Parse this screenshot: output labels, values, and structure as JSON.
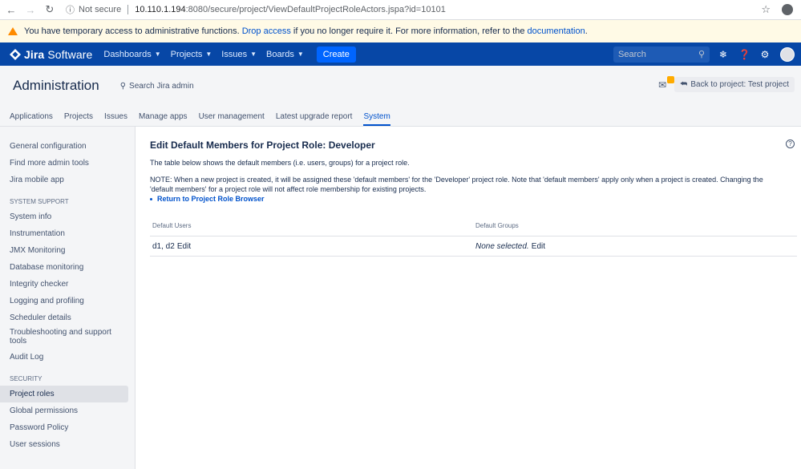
{
  "browser": {
    "not_secure": "Not secure",
    "url_host": "10.110.1.194",
    "url_path": ":8080/secure/project/ViewDefaultProjectRoleActors.jspa?id=10101"
  },
  "banner": {
    "text_before": "You have temporary access to administrative functions.",
    "link1": "Drop access",
    "text_middle": "if you no longer require it. For more information, refer to the",
    "link2": "documentation",
    "text_after": "."
  },
  "topnav": {
    "logo_product": "Jira",
    "logo_suffix": "Software",
    "menu": [
      "Dashboards",
      "Projects",
      "Issues",
      "Boards"
    ],
    "create": "Create",
    "search_placeholder": "Search"
  },
  "admin": {
    "title": "Administration",
    "search": "Search Jira admin",
    "back_button": "Back to project: Test project",
    "badge": "!"
  },
  "tabs": [
    "Applications",
    "Projects",
    "Issues",
    "Manage apps",
    "User management",
    "Latest upgrade report",
    "System"
  ],
  "sidebar": {
    "top_items": [
      "General configuration",
      "Find more admin tools",
      "Jira mobile app"
    ],
    "system_support_heading": "SYSTEM SUPPORT",
    "system_support_items": [
      "System info",
      "Instrumentation",
      "JMX Monitoring",
      "Database monitoring",
      "Integrity checker",
      "Logging and profiling",
      "Scheduler details",
      "Troubleshooting and support tools",
      "Audit Log"
    ],
    "security_heading": "SECURITY",
    "security_items": [
      "Project roles",
      "Global permissions",
      "Password Policy",
      "User sessions"
    ]
  },
  "main": {
    "heading": "Edit Default Members for Project Role: Developer",
    "desc": "The table below shows the default members (i.e. users, groups) for a project role.",
    "note": "NOTE: When a new project is created, it will be assigned these 'default members' for the 'Developer' project role. Note that 'default members' apply only when a project is created. Changing the 'default members' for a project role will not affect role membership for existing projects.",
    "return_link": "Return to Project Role Browser",
    "table": {
      "col_users": "Default Users",
      "col_groups": "Default Groups",
      "users_value": "d1, d2",
      "groups_value": "None selected.",
      "edit": "Edit"
    }
  },
  "colors": {
    "topnav": "#0747a6",
    "create": "#0065ff",
    "link": "#0052cc",
    "banner": "#fffae6",
    "warning": "#ff8b00"
  }
}
